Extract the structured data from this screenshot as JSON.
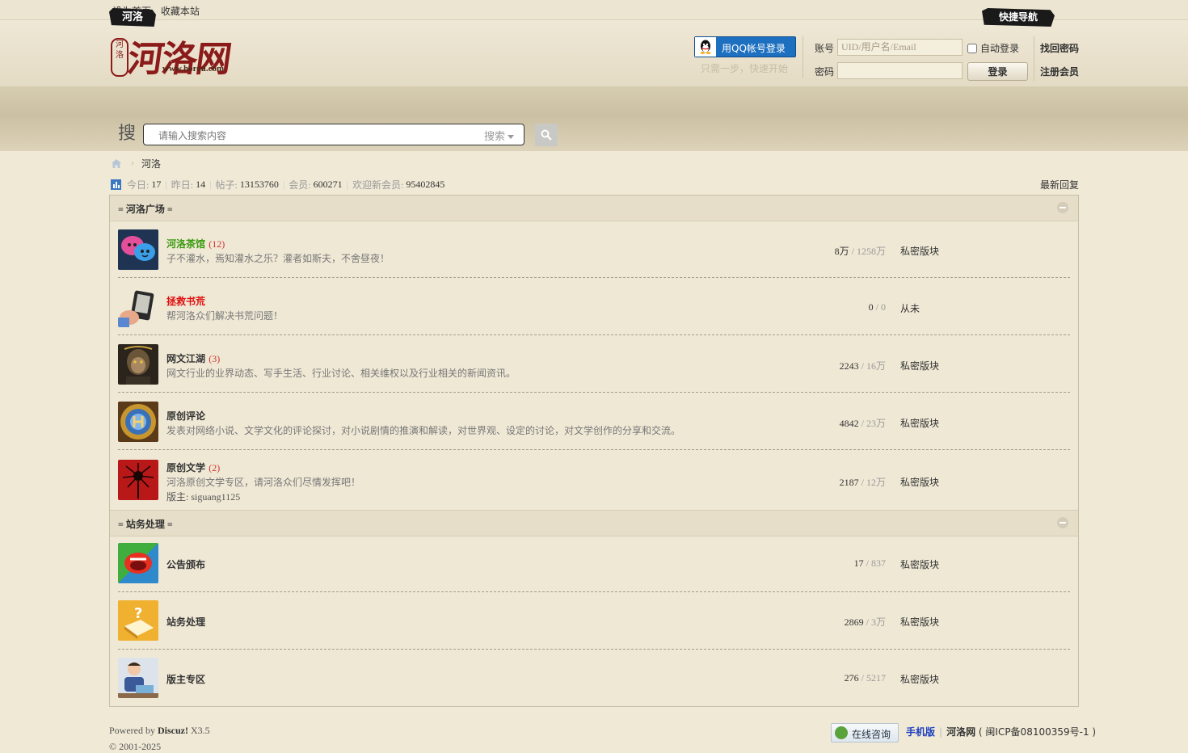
{
  "topbar": {
    "set_home": "设为首页",
    "bookmark": "收藏本站"
  },
  "logo": {
    "main": "河洛网",
    "seal": "河洛",
    "url": "www.horou.com"
  },
  "login": {
    "qq_label": "用QQ帐号登录",
    "qq_hint": "只需一步，快速开始",
    "account_label": "账号",
    "account_placeholder": "UID/用户名/Email",
    "password_label": "密码",
    "autologin_label": "自动登录",
    "login_button": "登录",
    "find_password": "找回密码",
    "register": "注册会员"
  },
  "nav": {
    "tab": "河洛",
    "quick_nav": "快捷导航"
  },
  "search": {
    "char": "搜",
    "placeholder": "请输入搜索内容",
    "type_label": "搜索"
  },
  "breadcrumb": {
    "current": "河洛"
  },
  "stats": {
    "today_label": "今日:",
    "today": "17",
    "yesterday_label": "昨日:",
    "yesterday": "14",
    "posts_label": "帖子:",
    "posts": "13153760",
    "members_label": "会员:",
    "members": "600271",
    "newest_label": "欢迎新会员:",
    "newest": "95402845",
    "latest_replies": "最新回复"
  },
  "categories": [
    {
      "title": "= 河洛广场 =",
      "forums": [
        {
          "name": "河洛茶馆",
          "name_color": "#3a9a10",
          "today": "(12)",
          "desc": "子不灌水，焉知灌水之乐？灌者如斯夫，不舍昼夜！",
          "threads": "8万",
          "posts": "1258万",
          "last": "私密版块",
          "icon": "chat-bubbles-icon"
        },
        {
          "name": "拯救书荒",
          "name_color": "#e01010",
          "today": "",
          "desc": "帮河洛众们解决书荒问题！",
          "threads": "0",
          "posts": "0",
          "last": "从未",
          "icon": "ebook-reader-icon"
        },
        {
          "name": "网文江湖",
          "name_color": "#333333",
          "today": "(3)",
          "desc": "网文行业的业界动态、写手生活、行业讨论、相关维权以及行业相关的新闻资讯。",
          "threads": "2243",
          "posts": "16万",
          "last": "私密版块",
          "icon": "monkey-warrior-icon"
        },
        {
          "name": "原创评论",
          "name_color": "#333333",
          "today": "",
          "desc": "发表对网络小说、文学文化的评论探讨，对小说剧情的推演和解读，对世界观、设定的讨论，对文学创作的分享和交流。",
          "threads": "4842",
          "posts": "23万",
          "last": "私密版块",
          "icon": "hearth-emblem-icon"
        },
        {
          "name": "原创文学",
          "name_color": "#333333",
          "today": "(2)",
          "desc": "河洛原创文学专区，请河洛众们尽情发挥吧！",
          "moderator": "版主: siguang1125",
          "threads": "2187",
          "posts": "12万",
          "last": "私密版块",
          "icon": "red-spider-lily-icon"
        }
      ]
    },
    {
      "title": "= 站务处理 =",
      "forums": [
        {
          "name": "公告颁布",
          "name_color": "#333333",
          "today": "",
          "desc": "",
          "threads": "17",
          "posts": "837",
          "last": "私密版块",
          "icon": "megaphone-mouth-icon"
        },
        {
          "name": "站务处理",
          "name_color": "#333333",
          "today": "",
          "desc": "",
          "threads": "2869",
          "posts": "3万",
          "last": "私密版块",
          "icon": "question-book-icon"
        },
        {
          "name": "版主专区",
          "name_color": "#333333",
          "today": "",
          "desc": "",
          "threads": "276",
          "posts": "5217",
          "last": "私密版块",
          "icon": "person-reading-icon"
        }
      ]
    }
  ],
  "footer": {
    "powered_by": "Powered by",
    "engine": "Discuz!",
    "version": "X3.5",
    "online_consult": "在线咨询",
    "mobile": "手机版",
    "site_name": "河洛网",
    "icp": "( 闽ICP备08100359号-1 )",
    "copyright": "© 2001-2025"
  }
}
